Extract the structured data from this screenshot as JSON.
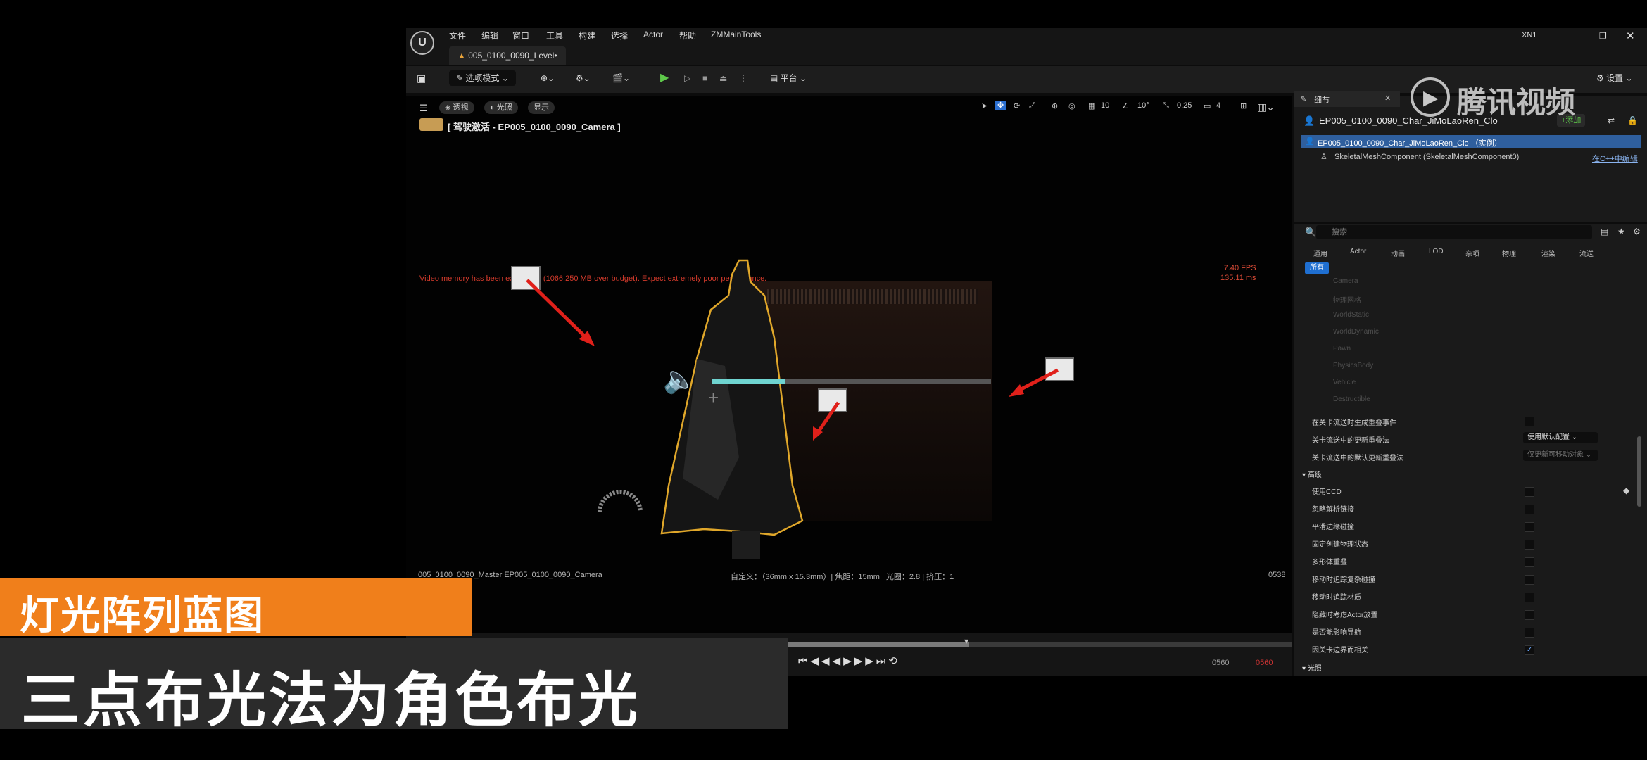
{
  "menubar": {
    "items": [
      "文件",
      "编辑",
      "窗口",
      "工具",
      "构建",
      "选择",
      "Actor",
      "帮助",
      "ZMMainTools"
    ],
    "user": "XN1"
  },
  "level_tab": "005_0100_0090_Level•",
  "toolbar": {
    "mode": "选项模式",
    "platform": "平台",
    "settings": "设置"
  },
  "viewport": {
    "pills": [
      "透视",
      "光照",
      "显示"
    ],
    "camera_label": "[ 驾驶激活 - EP005_0100_0090_Camera ]",
    "warning": "Video memory has been exhausted (1066.250 MB over budget). Expect extremely poor performance.",
    "fps": "7.40 FPS",
    "ms": "135.11 ms",
    "grid_value": "10",
    "angle_value": "10°",
    "scale_value": "0.25",
    "cam_speed": "4",
    "bottom_left": "005_0100_0090_Master  EP005_0100_0090_Camera",
    "bottom_mid": "自定义：（36mm x 15.3mm）| 焦距：15mm | 光圈：2.8 | 挤压：1",
    "frame": "0538",
    "volume_fraction": 0.26
  },
  "timeline": {
    "start": "0560",
    "end": "0560"
  },
  "details": {
    "tab": "细节",
    "actor_name": "EP005_0100_0090_Char_JiMoLaoRen_Clo",
    "add_button": "+添加",
    "root_item": "EP005_0100_0090_Char_JiMoLaoRen_Clo （实例）",
    "component": "SkeletalMeshComponent (SkeletalMeshComponent0)",
    "edit_cpp": "在C++中编辑",
    "search_placeholder": "搜索",
    "categories": [
      "通用",
      "Actor",
      "动画",
      "LOD",
      "杂项",
      "物理",
      "渲染",
      "流送"
    ],
    "all_tab": "所有",
    "faded_rows": [
      "Camera",
      "物理网格",
      "WorldStatic",
      "WorldDynamic",
      "Pawn",
      "PhysicsBody",
      "Vehicle",
      "Destructible"
    ],
    "rows": [
      {
        "label": "在关卡流送时生成重叠事件",
        "kind": "checkbox"
      },
      {
        "label": "关卡流送中的更新重叠法",
        "kind": "dropdown",
        "value": "使用默认配置"
      },
      {
        "label": "关卡流送中的默认更新重叠法",
        "kind": "dropdown",
        "value": "仅更新可移动对象"
      }
    ],
    "section_advanced": "高级",
    "advanced_rows": [
      "使用CCD",
      "忽略解析链接",
      "平滑边缘碰撞",
      "固定创建物理状态",
      "多形体重叠",
      "移动时追踪复杂碰撞",
      "移动时追踪材质",
      "隐藏时考虑Actor放置",
      "是否能影响导航",
      "因关卡边界而相关"
    ],
    "section_lod": "光照"
  },
  "watermark": "腾讯视频",
  "captions": {
    "line1": "灯光阵列蓝图",
    "line2": "三点布光法为角色布光"
  },
  "colors": {
    "caption_orange": "#f07f1b",
    "caption_dark": "#2b2b2b",
    "warning_red": "#d63b2c",
    "selection_blue": "#1f6fd1",
    "arrow_red": "#e0201a",
    "outline_yellow": "#e0a72a"
  }
}
